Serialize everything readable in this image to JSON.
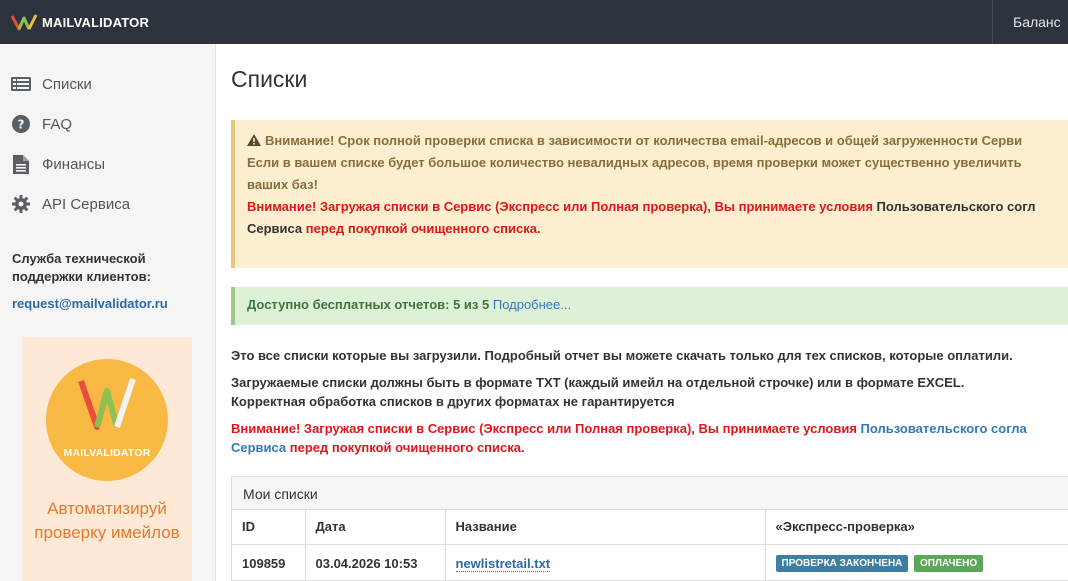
{
  "brand": {
    "name": "MAILVALIDATOR"
  },
  "topbar": {
    "balance_label": "Баланс"
  },
  "sidebar": {
    "items": [
      {
        "label": "Списки",
        "icon": "list-icon"
      },
      {
        "label": "FAQ",
        "icon": "question-icon"
      },
      {
        "label": "Финансы",
        "icon": "document-icon"
      },
      {
        "label": "API Сервиса",
        "icon": "gear-icon"
      }
    ],
    "support_title": "Служба технической поддержки клиентов:",
    "support_email": "request@mailvalidator.ru",
    "promo": {
      "logo_mail": "MAIL",
      "logo_validator": "VALIDATOR",
      "text": "Автоматизируй проверку имейлов"
    }
  },
  "page": {
    "title": "Списки",
    "warning": {
      "line1": "Внимание! Срок полной проверки списка в зависимости от количества email-адресов и общей загруженности Серви",
      "line2a": "Если в вашем списке будет большое количество невалидных адресов, время проверки может существенно увеличить",
      "line2b": "ваших баз!",
      "line3_red": "Внимание! Загружая списки в Сервис (Экспресс или Полная проверка), Вы принимаете условия ",
      "line3_dark": "Пользовательского согл",
      "line4_dark": "Сервиса ",
      "line4_red": "перед покупкой очищенного списка."
    },
    "free_reports": {
      "label": "Доступно бесплатных отчетов: 5 из 5",
      "link": "Подробнее..."
    },
    "info1": "Это все списки которые вы загрузили. Подробный отчет вы можете скачать только для тех списков, которые оплатили.",
    "info2a": "Загружаемые списки должны быть в формате TXT (каждый имейл на отдельной строчке) или в формате EXCEL.",
    "info2b": "Корректная обработка списков в других форматах не гарантируется",
    "notice_red": "Внимание! Загружая списки в Сервис (Экспресс или Полная проверка), Вы принимаете условия ",
    "notice_link": "Пользовательского согла",
    "notice_link2": "Сервиса",
    "notice_red2": " перед покупкой очищенного списка."
  },
  "lists_panel": {
    "title": "Мои списки",
    "columns": [
      "ID",
      "Дата",
      "Название",
      "«Экспресс-проверка»"
    ],
    "rows": [
      {
        "id": "109859",
        "date": "03.04.2026 10:53",
        "name": "newlistretail.txt",
        "status": "ПРОВЕРКА ЗАКОНЧЕНА",
        "paid": "ОПЛАЧЕНО"
      }
    ]
  },
  "colors": {
    "topbar": "#2c333c",
    "sidebar": "#f5f5f5",
    "warning_bg": "#fbefcf",
    "success_bg": "#dff0d8",
    "alert_red": "#e0161c",
    "link_blue": "#337ab7",
    "promo_orange": "#f8b844"
  }
}
